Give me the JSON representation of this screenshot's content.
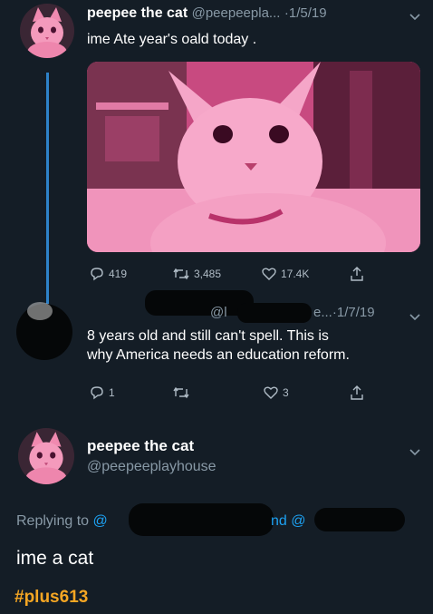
{
  "tweet1": {
    "author": "peepee the cat",
    "handle": "@peepeepla...",
    "dot": "·",
    "date": "1/5/19",
    "text": "ime Ate year's oald today .",
    "stats": {
      "replies": "419",
      "retweets": "3,485",
      "likes": "17.4K"
    }
  },
  "tweet2": {
    "handle_visible": "@l",
    "handle_tail": "e...",
    "dot": "·",
    "date": "1/7/19",
    "text_line1": "8 years old and still can't spell. This is",
    "text_line2": "why America needs an education reform.",
    "stats": {
      "replies": "1",
      "likes": "3"
    }
  },
  "reply": {
    "author": "peepee the cat",
    "handle": "@peepeeplayhouse",
    "replying_prefix": "Replying to",
    "replying_at1": "@",
    "replying_and": "nd @",
    "text": "ime a cat"
  },
  "watermark": "#plus613",
  "colors": {
    "background": "#141d26",
    "link": "#1da1f2",
    "thread_line": "#2e82c9",
    "watermark": "#f5a623",
    "photo_tint": "#d9558f"
  },
  "icons": [
    "reply-icon",
    "retweet-icon",
    "like-icon",
    "share-icon",
    "chevron-down-icon"
  ]
}
